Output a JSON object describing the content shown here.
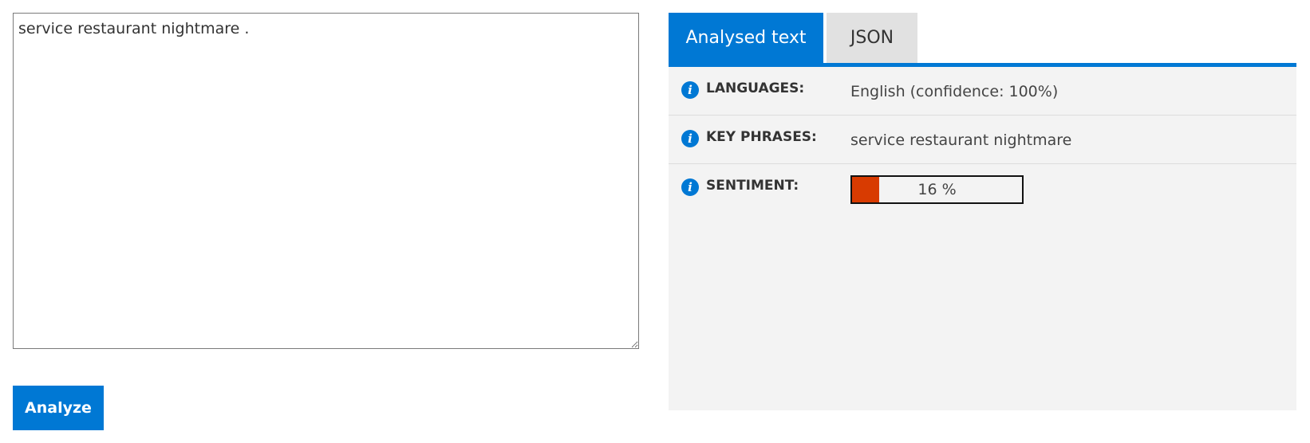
{
  "input": {
    "text": "service restaurant nightmare ."
  },
  "analyze_button_label": "Analyze",
  "tabs": [
    {
      "label": "Analysed text",
      "active": true
    },
    {
      "label": "JSON",
      "active": false
    }
  ],
  "results": {
    "languages": {
      "label": "LANGUAGES:",
      "value": "English (confidence: 100%)"
    },
    "key_phrases": {
      "label": "KEY PHRASES:",
      "value": "service restaurant nightmare"
    },
    "sentiment": {
      "label": "SENTIMENT:",
      "value_text": "16 %",
      "value": 0.16
    }
  },
  "icons": {
    "info": "info-icon"
  },
  "colors": {
    "accent": "#0078d4",
    "sentiment_fill": "#d83b01",
    "panel_bg": "#f3f3f3",
    "inactive_tab_bg": "#e1e1e1"
  }
}
